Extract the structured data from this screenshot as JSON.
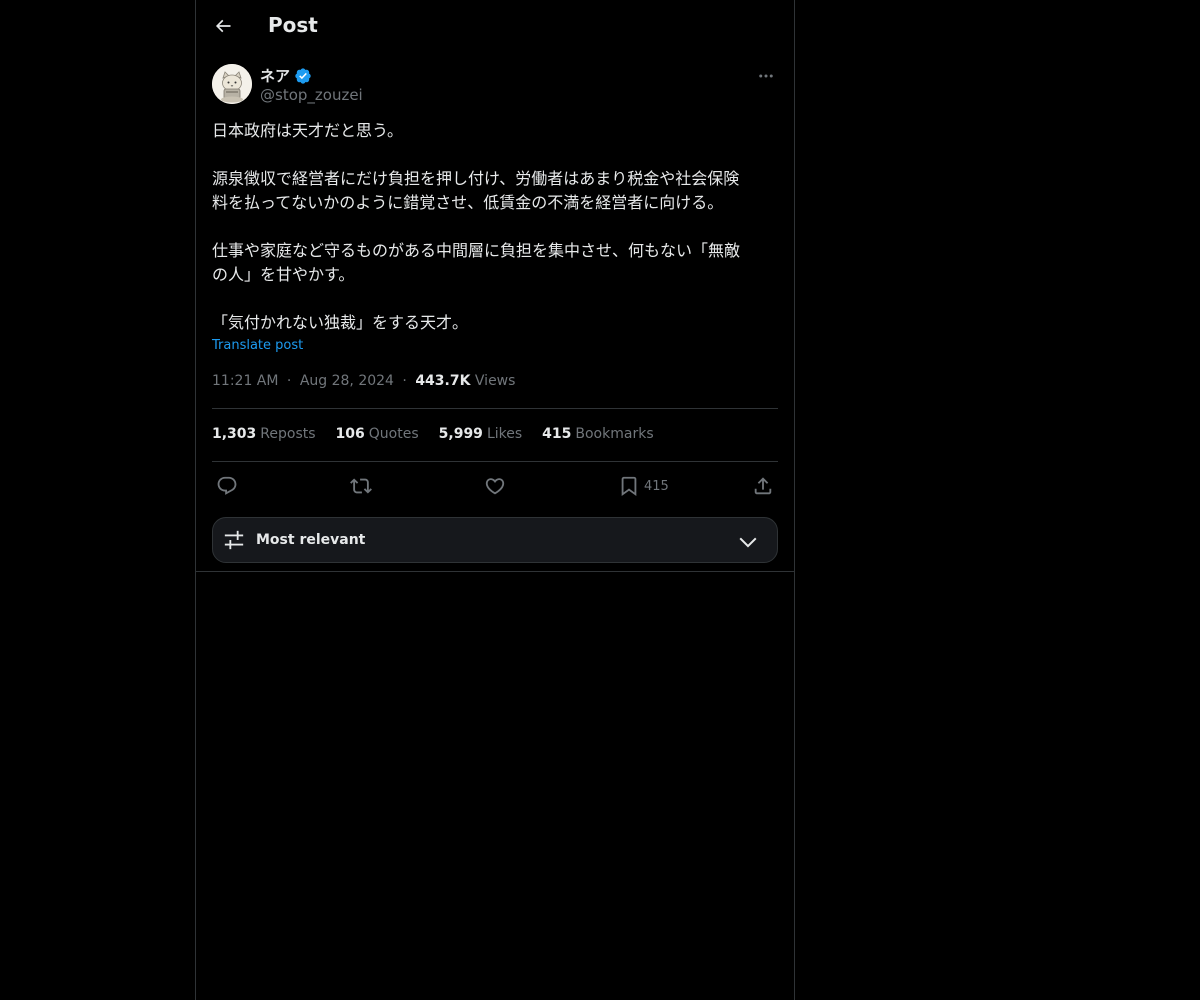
{
  "header": {
    "title": "Post",
    "back_icon": "arrow-left-icon"
  },
  "tweet": {
    "author": {
      "name": "ネア",
      "handle": "@stop_zouzei",
      "verified": true,
      "verified_color": "#1d9bf0"
    },
    "paragraphs": [
      "日本政府は天才だと思う。",
      "",
      "源泉徴収で経営者にだけ負担を押し付け、労働者はあまり税金や社会保険",
      "料を払ってないかのように錯覚させ、低賃金の不満を経営者に向ける。",
      "",
      "仕事や家庭など守るものがある中間層に負担を集中させ、何もない「無敵",
      "の人」を甘やかす。",
      "",
      "「気付かれない独裁」をする天才。"
    ],
    "translate_label": "Translate post",
    "time": "11:21 AM",
    "date": "Aug 28, 2024",
    "views_count": "443.7K",
    "views_label": "Views",
    "separator": "·"
  },
  "stats": {
    "reposts": {
      "count": "1,303",
      "label": "Reposts"
    },
    "quotes": {
      "count": "106",
      "label": "Quotes"
    },
    "likes": {
      "count": "5,999",
      "label": "Likes"
    },
    "bookmarks": {
      "count": "415",
      "label": "Bookmarks"
    }
  },
  "actions": {
    "reply_icon": "reply-icon",
    "repost_icon": "repost-icon",
    "like_icon": "heart-icon",
    "bookmark_icon": "bookmark-icon",
    "bookmark_count": "415",
    "share_icon": "share-icon"
  },
  "replies_sort": {
    "label": "Most relevant"
  },
  "colors": {
    "background": "#000000",
    "text": "#e7e9ea",
    "muted": "#71767b",
    "accent": "#1d9bf0",
    "border": "#2f3336"
  }
}
